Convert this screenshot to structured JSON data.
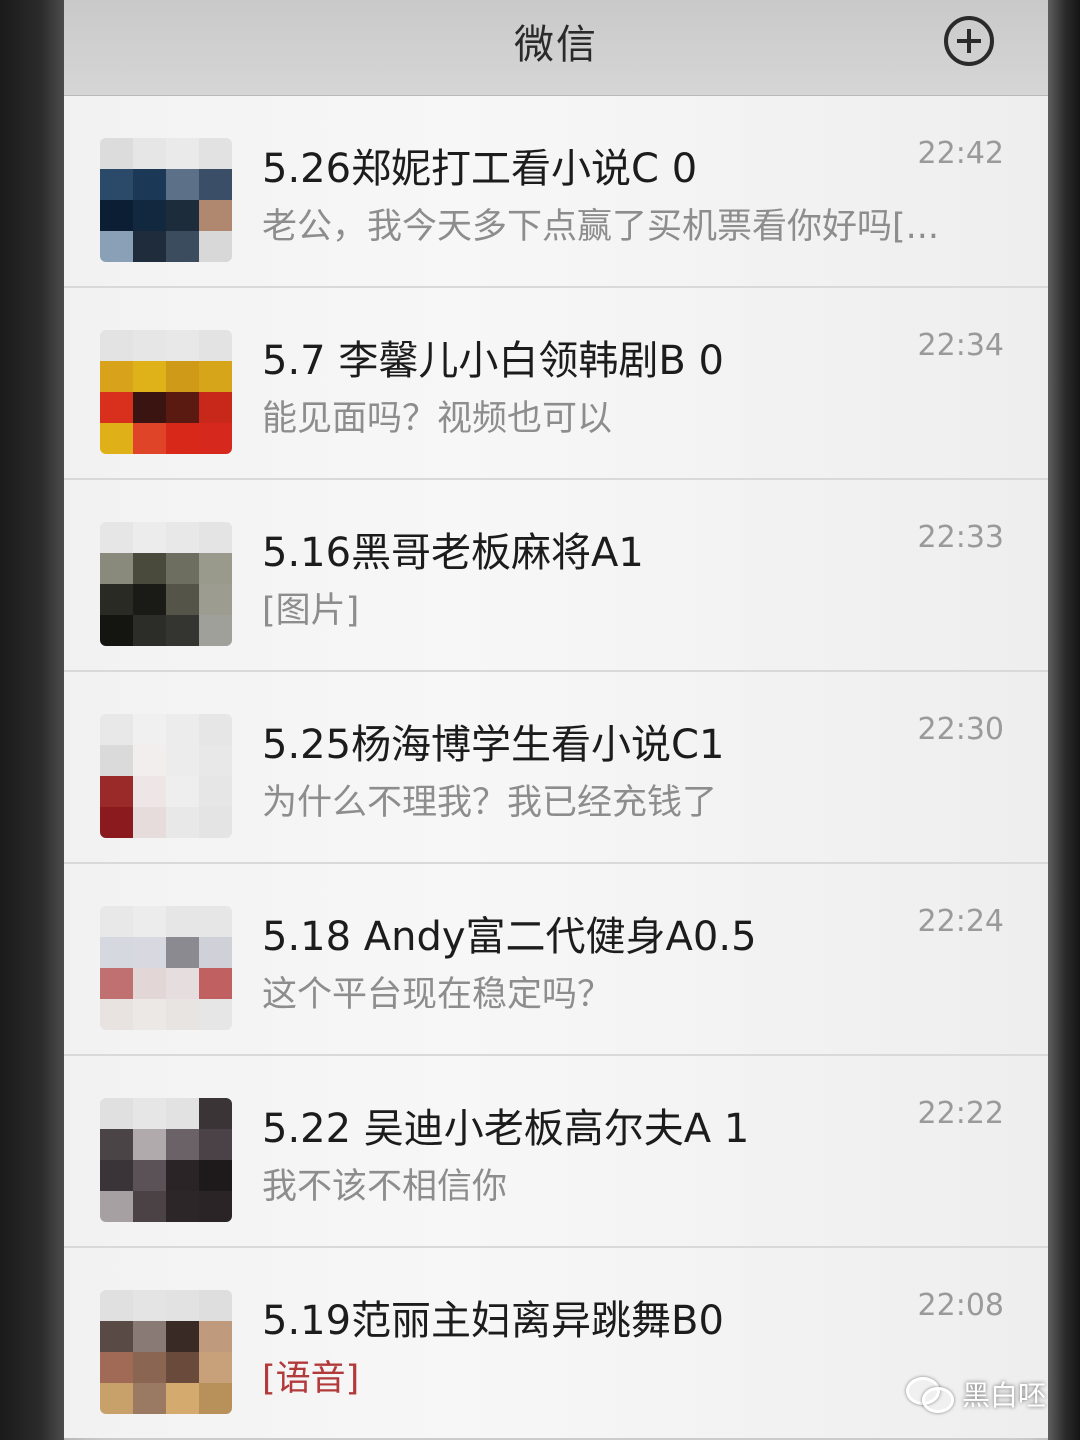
{
  "header": {
    "title": "微信",
    "plus_icon": "plus-circle-icon"
  },
  "chats": [
    {
      "name": "5.26郑妮打工看小说C 0",
      "time": "22:42",
      "message": "老公，我今天多下点赢了买机票看你好吗[...",
      "avatar_colors": [
        "#dcdcdc",
        "#e6e6e6",
        "#eaeaea",
        "#e2e2e2",
        "#2b4a6a",
        "#1b3857",
        "#5c7088",
        "#3a4e68",
        "#0b1e33",
        "#11283f",
        "#1d2c3b",
        "#b08870",
        "#8aa0b6",
        "#1e2c3c",
        "#3a4c5e",
        "#d8d8d8"
      ]
    },
    {
      "name": "5.7 李馨儿小白领韩剧B 0",
      "time": "22:34",
      "message": "能见面吗？视频也可以",
      "avatar_colors": [
        "#e3e3e3",
        "#e6e6e6",
        "#e8e8e8",
        "#e3e3e3",
        "#d8a21a",
        "#e0b21a",
        "#cf9a18",
        "#d6a51a",
        "#d8301c",
        "#3a1410",
        "#5a1a12",
        "#c8281a",
        "#e0b018",
        "#e04428",
        "#d8281a",
        "#d6281c"
      ]
    },
    {
      "name": "5.16黑哥老板麻将A1",
      "time": "22:33",
      "message": "[图片]",
      "avatar_colors": [
        "#e6e6e6",
        "#ececec",
        "#e8e8e8",
        "#e4e4e4",
        "#8a8a7c",
        "#4a4a3c",
        "#6e6e60",
        "#9a9a8c",
        "#2a2a24",
        "#1a1a16",
        "#545448",
        "#9c9c90",
        "#141410",
        "#2c2c28",
        "#343430",
        "#a0a09a"
      ]
    },
    {
      "name": "5.25杨海博学生看小说C1",
      "time": "22:30",
      "message": "为什么不理我？我已经充钱了",
      "avatar_colors": [
        "#e8e8e8",
        "#f0f0f0",
        "#ececec",
        "#e6e6e6",
        "#dadada",
        "#f2eeee",
        "#ececec",
        "#e8e8e8",
        "#9a2a2a",
        "#eee6e6",
        "#eeeeee",
        "#e6e6e6",
        "#8a1a1e",
        "#e6dcdc",
        "#e8e8e8",
        "#e4e4e4"
      ]
    },
    {
      "name": "5.18 Andy富二代健身A0.5",
      "time": "22:24",
      "message": "这个平台现在稳定吗？",
      "avatar_colors": [
        "#e8e8e8",
        "#ececec",
        "#e6e6e6",
        "#e6e6e6",
        "#d6d8e0",
        "#d8d8e0",
        "#8a8a90",
        "#d0d0d8",
        "#c07070",
        "#e2d6d6",
        "#e6dede",
        "#c06060",
        "#e8e2e0",
        "#ece8e6",
        "#e8e4e2",
        "#e6e6e6"
      ]
    },
    {
      "name": "5.22 吴迪小老板高尔夫A 1",
      "time": "22:22",
      "message": "我不该不相信你",
      "avatar_colors": [
        "#e0e0e0",
        "#e6e6e6",
        "#e2e2e2",
        "#3a3436",
        "#4a4446",
        "#b0aaac",
        "#6a6266",
        "#4a4246",
        "#3a3438",
        "#5a5256",
        "#2a2426",
        "#1e1a1c",
        "#a6a0a2",
        "#4a4244",
        "#2c2628",
        "#2a2426"
      ]
    },
    {
      "name": "5.19范丽主妇离异跳舞B0",
      "time": "22:08",
      "message": "[语音]",
      "message_red": true,
      "avatar_colors": [
        "#e0e0e0",
        "#e4e4e4",
        "#e2e2e2",
        "#dedede",
        "#5a4a46",
        "#8a7a76",
        "#3a2a26",
        "#c09a7c",
        "#a06a56",
        "#8a6652",
        "#6a4a3a",
        "#c8a07a",
        "#c8a06a",
        "#9a7a62",
        "#d4aa6e",
        "#b8905a"
      ]
    }
  ],
  "watermark": {
    "text": "黑白呸",
    "icon": "wechat-icon"
  }
}
